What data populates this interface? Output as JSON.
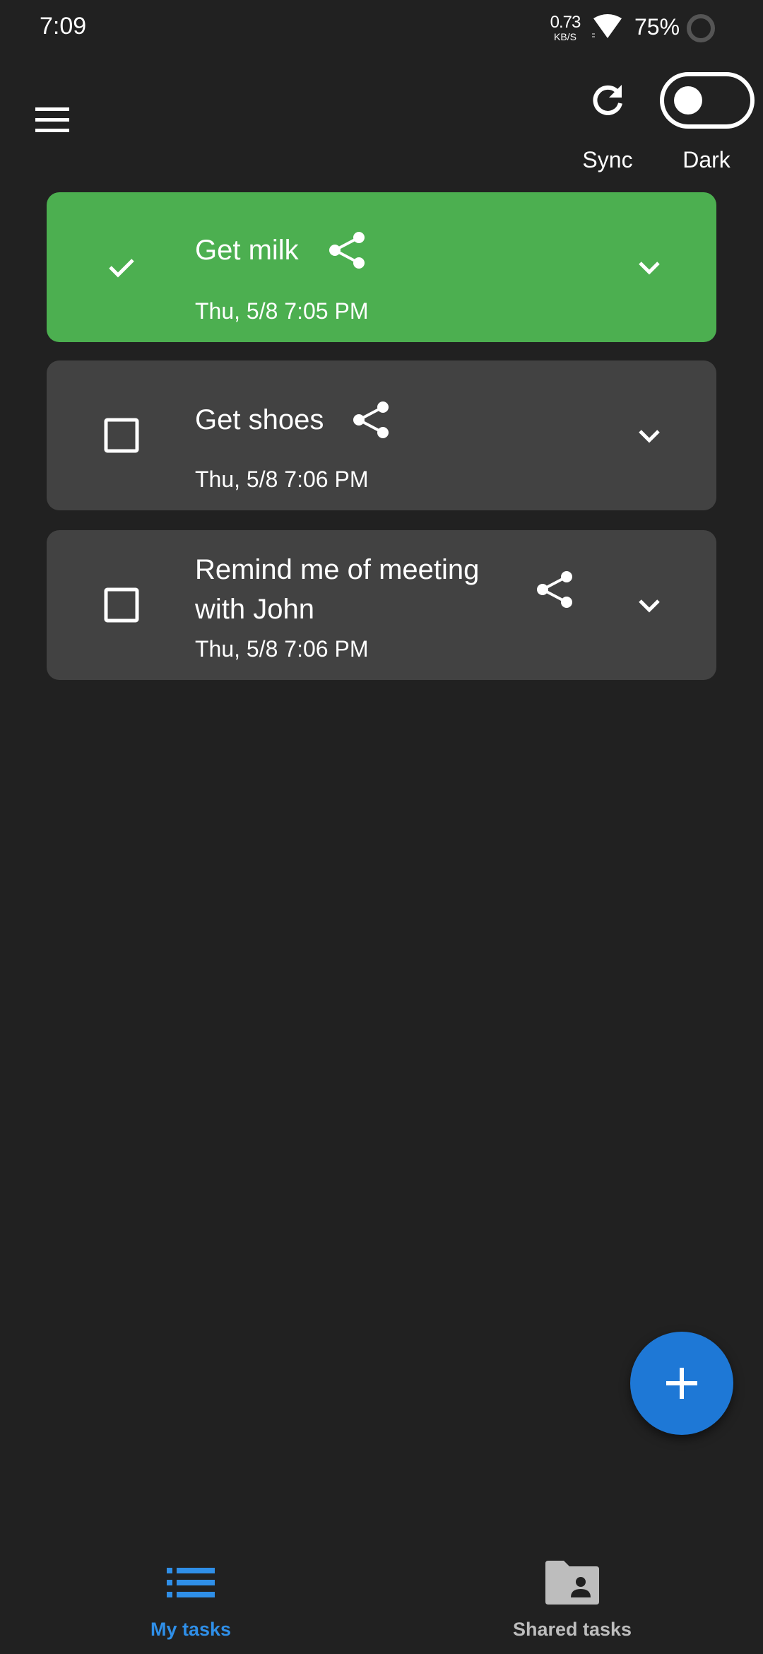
{
  "status_bar": {
    "time": "7:09",
    "net_speed_value": "0.73",
    "net_speed_unit": "KB/S",
    "battery_percent": "75%",
    "battery_level": 0.75
  },
  "app_bar": {
    "sync_label": "Sync",
    "dark_label": "Dark",
    "dark_mode_on": false
  },
  "tasks": [
    {
      "title": "Get milk",
      "date": "Thu, 5/8 7:05 PM",
      "completed": true
    },
    {
      "title": "Get shoes",
      "date": "Thu, 5/8 7:06 PM",
      "completed": false
    },
    {
      "title_line1": "Remind me of meeting",
      "title_line2": "with John",
      "date": "Thu, 5/8 7:06 PM",
      "completed": false
    }
  ],
  "bottom_nav": {
    "items": [
      {
        "label": "My tasks",
        "icon": "list-icon",
        "active": true
      },
      {
        "label": "Shared tasks",
        "icon": "shared-folder-icon",
        "active": false
      }
    ]
  },
  "colors": {
    "background": "#212121",
    "card": "#424242",
    "card_done": "#4caf50",
    "accent": "#1e78d6",
    "nav_active": "#2f8fe8",
    "nav_inactive": "#bdbdbd"
  },
  "icons": {
    "menu": "menu-icon",
    "sync": "sync-icon",
    "share": "share-icon",
    "expand": "chevron-down-icon",
    "fab": "plus-icon"
  }
}
